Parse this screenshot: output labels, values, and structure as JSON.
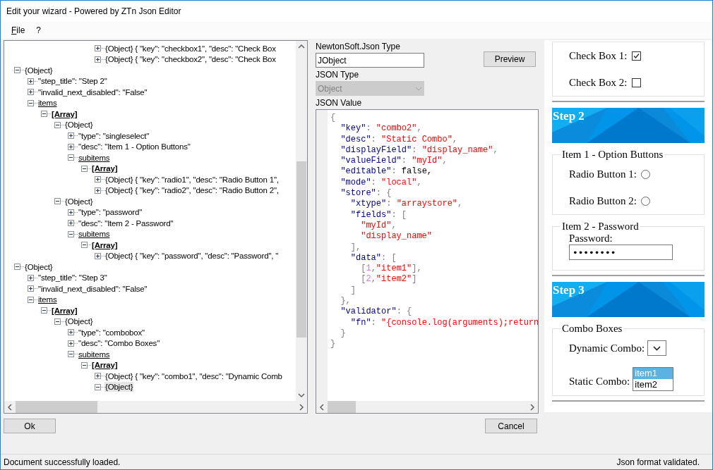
{
  "window": {
    "title": "Edit your wizard - Powered by ZTn Json Editor"
  },
  "menu": [
    {
      "mnemonic": "F",
      "label": "ile"
    },
    {
      "label": "?"
    }
  ],
  "tree": {
    "nodes": [
      {
        "children": [
          {
            "children": [
              {
                "children": [
                  {
                    "children": [
                      {
                        "children": [
                          {
                            "children": [
                              {
                                "label": "{Object} {  \"key\": \"checkbox1\",  \"desc\": \"Check Box",
                                "kind": "plain",
                                "expanded": false,
                                "selected": false
                              },
                              {
                                "label": "{Object} {  \"key\": \"checkbox2\",  \"desc\": \"Check Box",
                                "kind": "plain",
                                "expanded": false,
                                "selected": false
                              }
                            ]
                          }
                        ]
                      }
                    ]
                  }
                ]
              }
            ]
          }
        ]
      },
      {
        "label": "{Object}",
        "kind": "plain",
        "expanded": true,
        "selected": false,
        "children": [
          {
            "label": "\"step_title\": \"Step 2\"",
            "kind": "plain",
            "expanded": false,
            "selected": false
          },
          {
            "label": "\"invalid_next_disabled\": \"False\"",
            "kind": "plain",
            "expanded": false,
            "selected": false
          },
          {
            "label": "items",
            "kind": "link",
            "expanded": true,
            "selected": false,
            "children": [
              {
                "label": "[Array]",
                "kind": "array",
                "expanded": true,
                "selected": false,
                "children": [
                  {
                    "label": "{Object}",
                    "kind": "plain",
                    "expanded": true,
                    "selected": false,
                    "children": [
                      {
                        "label": "\"type\": \"singleselect\"",
                        "kind": "plain",
                        "expanded": false,
                        "selected": false
                      },
                      {
                        "label": "\"desc\": \"Item 1 - Option Buttons\"",
                        "kind": "plain",
                        "expanded": false,
                        "selected": false
                      },
                      {
                        "label": "subitems",
                        "kind": "link",
                        "expanded": true,
                        "selected": false,
                        "children": [
                          {
                            "label": "[Array]",
                            "kind": "array",
                            "expanded": true,
                            "selected": false,
                            "children": [
                              {
                                "label": "{Object} {  \"key\": \"radio1\",  \"desc\": \"Radio Button 1\",",
                                "kind": "plain",
                                "expanded": false,
                                "selected": false
                              },
                              {
                                "label": "{Object} {  \"key\": \"radio2\",  \"desc\": \"Radio Button 2\",",
                                "kind": "plain",
                                "expanded": false,
                                "selected": false
                              }
                            ]
                          }
                        ]
                      }
                    ]
                  },
                  {
                    "label": "{Object}",
                    "kind": "plain",
                    "expanded": true,
                    "selected": false,
                    "children": [
                      {
                        "label": "\"type\": \"password\"",
                        "kind": "plain",
                        "expanded": false,
                        "selected": false
                      },
                      {
                        "label": "\"desc\": \"Item 2 - Password\"",
                        "kind": "plain",
                        "expanded": false,
                        "selected": false
                      },
                      {
                        "label": "subitems",
                        "kind": "link",
                        "expanded": true,
                        "selected": false,
                        "children": [
                          {
                            "label": "[Array]",
                            "kind": "array",
                            "expanded": true,
                            "selected": false,
                            "children": [
                              {
                                "label": "{Object} {  \"key\": \"password\",  \"desc\": \"Password\",  \"",
                                "kind": "plain",
                                "expanded": false,
                                "selected": false
                              }
                            ]
                          }
                        ]
                      }
                    ]
                  }
                ]
              }
            ]
          }
        ]
      },
      {
        "label": "{Object}",
        "kind": "plain",
        "expanded": true,
        "selected": false,
        "children": [
          {
            "label": "\"step_title\": \"Step 3\"",
            "kind": "plain",
            "expanded": false,
            "selected": false
          },
          {
            "label": "\"invalid_next_disabled\": \"False\"",
            "kind": "plain",
            "expanded": false,
            "selected": false
          },
          {
            "label": "items",
            "kind": "link",
            "expanded": true,
            "selected": false,
            "children": [
              {
                "label": "[Array]",
                "kind": "array",
                "expanded": true,
                "selected": false,
                "children": [
                  {
                    "label": "{Object}",
                    "kind": "plain",
                    "expanded": true,
                    "selected": false,
                    "children": [
                      {
                        "label": "\"type\": \"combobox\"",
                        "kind": "plain",
                        "expanded": false,
                        "selected": false
                      },
                      {
                        "label": "\"desc\": \"Combo Boxes\"",
                        "kind": "plain",
                        "expanded": false,
                        "selected": false
                      },
                      {
                        "label": "subitems",
                        "kind": "link",
                        "expanded": true,
                        "selected": false,
                        "children": [
                          {
                            "label": "[Array]",
                            "kind": "array",
                            "expanded": true,
                            "selected": false,
                            "children": [
                              {
                                "label": "{Object} {  \"key\": \"combo1\",  \"desc\": \"Dynamic Comb",
                                "kind": "plain",
                                "expanded": false,
                                "selected": false
                              },
                              {
                                "label": "{Object}",
                                "kind": "plain",
                                "expanded": true,
                                "selected": true
                              }
                            ]
                          }
                        ]
                      }
                    ]
                  }
                ]
              }
            ]
          }
        ]
      }
    ]
  },
  "details": {
    "type_label": "NewtonSoft.Json Type",
    "type_value": "JObject",
    "preview_button": "Preview",
    "json_type_label": "JSON Type",
    "json_type_value": "Object",
    "json_type_disabled": true,
    "value_label": "JSON Value",
    "code": [
      [
        {
          "kind": "punct",
          "text": "{"
        }
      ],
      [
        {
          "kind": "key",
          "text": "  \"key\""
        },
        {
          "kind": "punct",
          "text": ": "
        },
        {
          "kind": "string",
          "text": "\"combo2\""
        },
        {
          "kind": "punct",
          "text": ","
        }
      ],
      [
        {
          "kind": "key",
          "text": "  \"desc\""
        },
        {
          "kind": "punct",
          "text": ": "
        },
        {
          "kind": "string",
          "text": "\"Static Combo\""
        },
        {
          "kind": "punct",
          "text": ","
        }
      ],
      [
        {
          "kind": "key",
          "text": "  \"displayField\""
        },
        {
          "kind": "punct",
          "text": ": "
        },
        {
          "kind": "string",
          "text": "\"display_name\""
        },
        {
          "kind": "punct",
          "text": ","
        }
      ],
      [
        {
          "kind": "key",
          "text": "  \"valueField\""
        },
        {
          "kind": "punct",
          "text": ": "
        },
        {
          "kind": "string",
          "text": "\"myId\""
        },
        {
          "kind": "punct",
          "text": ","
        }
      ],
      [
        {
          "kind": "key",
          "text": "  \"editable\""
        },
        {
          "kind": "punct",
          "text": ": "
        },
        {
          "kind": "literal",
          "text": "false,"
        }
      ],
      [
        {
          "kind": "key",
          "text": "  \"mode\""
        },
        {
          "kind": "punct",
          "text": ": "
        },
        {
          "kind": "string",
          "text": "\"local\""
        },
        {
          "kind": "punct",
          "text": ","
        }
      ],
      [
        {
          "kind": "key",
          "text": "  \"store\""
        },
        {
          "kind": "punct",
          "text": ": {"
        }
      ],
      [
        {
          "kind": "key",
          "text": "    \"xtype\""
        },
        {
          "kind": "punct",
          "text": ": "
        },
        {
          "kind": "string",
          "text": "\"arraystore\""
        },
        {
          "kind": "punct",
          "text": ","
        }
      ],
      [
        {
          "kind": "key",
          "text": "    \"fields\""
        },
        {
          "kind": "punct",
          "text": ": ["
        }
      ],
      [
        {
          "kind": "string",
          "text": "      \"myId\""
        },
        {
          "kind": "punct",
          "text": ","
        }
      ],
      [
        {
          "kind": "string",
          "text": "      \"display_name\""
        }
      ],
      [
        {
          "kind": "punct",
          "text": "    ],"
        }
      ],
      [
        {
          "kind": "key",
          "text": "    \"data\""
        },
        {
          "kind": "punct",
          "text": ": ["
        }
      ],
      [
        {
          "kind": "punct",
          "text": "      ["
        },
        {
          "kind": "number",
          "text": "1"
        },
        {
          "kind": "punct",
          "text": ","
        },
        {
          "kind": "string",
          "text": "\"item1\""
        },
        {
          "kind": "punct",
          "text": "],"
        }
      ],
      [
        {
          "kind": "punct",
          "text": "      ["
        },
        {
          "kind": "number",
          "text": "2"
        },
        {
          "kind": "punct",
          "text": ","
        },
        {
          "kind": "string",
          "text": "\"item2\""
        },
        {
          "kind": "punct",
          "text": "]"
        }
      ],
      [
        {
          "kind": "punct",
          "text": "    ]"
        }
      ],
      [
        {
          "kind": "punct",
          "text": "  },"
        }
      ],
      [
        {
          "kind": "key",
          "text": "  \"validator\""
        },
        {
          "kind": "punct",
          "text": ": {"
        }
      ],
      [
        {
          "kind": "key",
          "text": "    \"fn\""
        },
        {
          "kind": "punct",
          "text": ": "
        },
        {
          "kind": "string",
          "text": "\"{console.log(arguments);return"
        }
      ],
      [
        {
          "kind": "punct",
          "text": "  }"
        }
      ],
      [
        {
          "kind": "punct",
          "text": "}"
        }
      ]
    ]
  },
  "preview": {
    "sections": [
      {
        "kind": "fields",
        "fieldsets": [
          {
            "items": [
              {
                "kind": "checkbox",
                "label": "Check Box 1:",
                "checked": true
              },
              {
                "kind": "checkbox",
                "label": "Check Box 2:",
                "checked": false
              }
            ]
          }
        ]
      },
      {
        "kind": "step",
        "title": "Step 2",
        "fieldsets": [
          {
            "legend": "Item 1 - Option Buttons",
            "items": [
              {
                "kind": "radio",
                "label": "Radio Button 1:",
                "checked": false
              },
              {
                "kind": "radio",
                "label": "Radio Button 2:",
                "checked": false
              }
            ]
          },
          {
            "legend": "Item 2 - Password",
            "items": [
              {
                "kind": "password",
                "label": "Password:",
                "value": "••••••••"
              }
            ]
          }
        ]
      },
      {
        "kind": "step",
        "title": "Step 3",
        "fieldsets": [
          {
            "legend": "Combo Boxes",
            "items": [
              {
                "kind": "dropdown",
                "label": "Dynamic Combo:"
              },
              {
                "kind": "listbox",
                "label": "Static Combo:",
                "options": [
                  {
                    "label": "item1",
                    "selected": true
                  },
                  {
                    "label": "item2",
                    "selected": false
                  }
                ]
              }
            ]
          }
        ]
      }
    ]
  },
  "buttons": {
    "ok": "Ok",
    "cancel": "Cancel"
  },
  "status_bar": {
    "left": "Document successfully loaded.",
    "right": "Json format validated."
  }
}
